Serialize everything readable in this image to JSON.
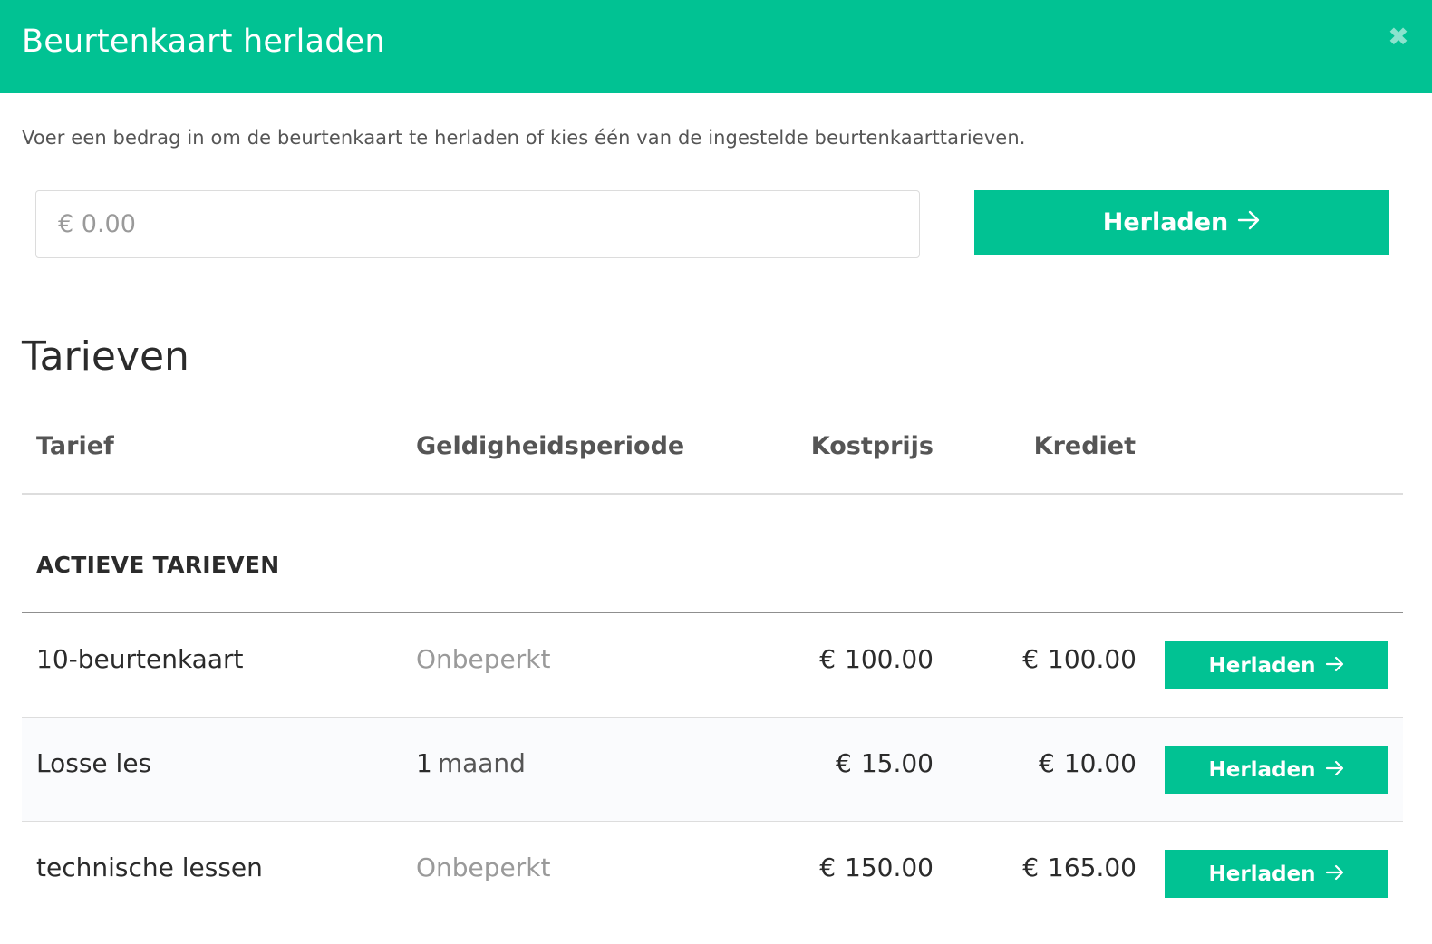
{
  "modal": {
    "title": "Beurtenkaart herladen",
    "close_icon": "close-icon",
    "header_color": "#01c293"
  },
  "intro": "Voer een bedrag in om de beurtenkaart te herladen of kies één van de ingestelde beurtenkaarttarieven.",
  "amount": {
    "value": "",
    "placeholder": "€ 0.00"
  },
  "main_button": {
    "label": "Herladen",
    "icon": "arrow-right-icon"
  },
  "tarieven": {
    "title": "Tarieven",
    "columns": {
      "tarief": "Tarief",
      "geldigheid": "Geldigheidsperiode",
      "kostprijs": "Kostprijs",
      "krediet": "Krediet"
    },
    "group_label": "ACTIEVE TARIEVEN",
    "rows": [
      {
        "name": "10-beurtenkaart",
        "period": "Onbeperkt",
        "period_unit": "",
        "currency": "€",
        "cost": "100.00",
        "credit": "100.00",
        "button_label": "Herladen"
      },
      {
        "name": "Losse les",
        "period": "1",
        "period_unit": "maand",
        "currency": "€",
        "cost": "15.00",
        "credit": "10.00",
        "button_label": "Herladen"
      },
      {
        "name": "technische lessen",
        "period": "Onbeperkt",
        "period_unit": "",
        "currency": "€",
        "cost": "150.00",
        "credit": "165.00",
        "button_label": "Herladen"
      }
    ]
  }
}
